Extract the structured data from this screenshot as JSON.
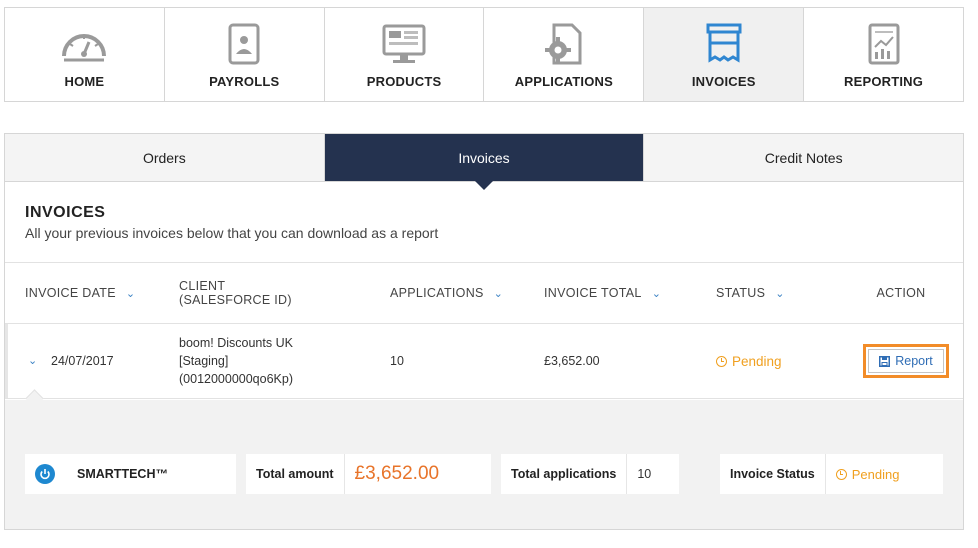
{
  "nav": {
    "items": [
      {
        "label": "HOME",
        "icon": "dashboard-gauge-icon",
        "active": false
      },
      {
        "label": "PAYROLLS",
        "icon": "contact-book-icon",
        "active": false
      },
      {
        "label": "PRODUCTS",
        "icon": "monitor-icon",
        "active": false
      },
      {
        "label": "APPLICATIONS",
        "icon": "document-gear-icon",
        "active": false
      },
      {
        "label": "INVOICES",
        "icon": "receipt-icon",
        "active": true
      },
      {
        "label": "REPORTING",
        "icon": "report-chart-icon",
        "active": false
      }
    ]
  },
  "colors": {
    "accent_dark": "#24324f",
    "link_blue": "#2f6db5",
    "pending_orange": "#f0a020",
    "highlight_orange": "#f28c28",
    "amount_orange": "#e8742a"
  },
  "subtabs": [
    "Orders",
    "Invoices",
    "Credit Notes"
  ],
  "section": {
    "title": "INVOICES",
    "subtitle": "All your previous invoices below that you can download as a report"
  },
  "table": {
    "headers": {
      "invoice_date": "INVOICE DATE",
      "client_line1": "CLIENT",
      "client_line2": "(SALESFORCE ID)",
      "applications": "APPLICATIONS",
      "invoice_total": "INVOICE TOTAL",
      "status": "STATUS",
      "action": "ACTION"
    },
    "row": {
      "date": "24/07/2017",
      "client_line1": "boom! Discounts UK",
      "client_line2": "[Staging]",
      "client_line3": "(0012000000qo6Kp)",
      "applications": "10",
      "total": "£3,652.00",
      "status": "Pending",
      "action": "Report"
    }
  },
  "summary": {
    "company": "SMARTTECH™",
    "total_amount_label": "Total amount",
    "total_amount_value": "£3,652.00",
    "total_applications_label": "Total applications",
    "total_applications_value": "10",
    "invoice_status_label": "Invoice Status",
    "invoice_status_value": "Pending"
  }
}
